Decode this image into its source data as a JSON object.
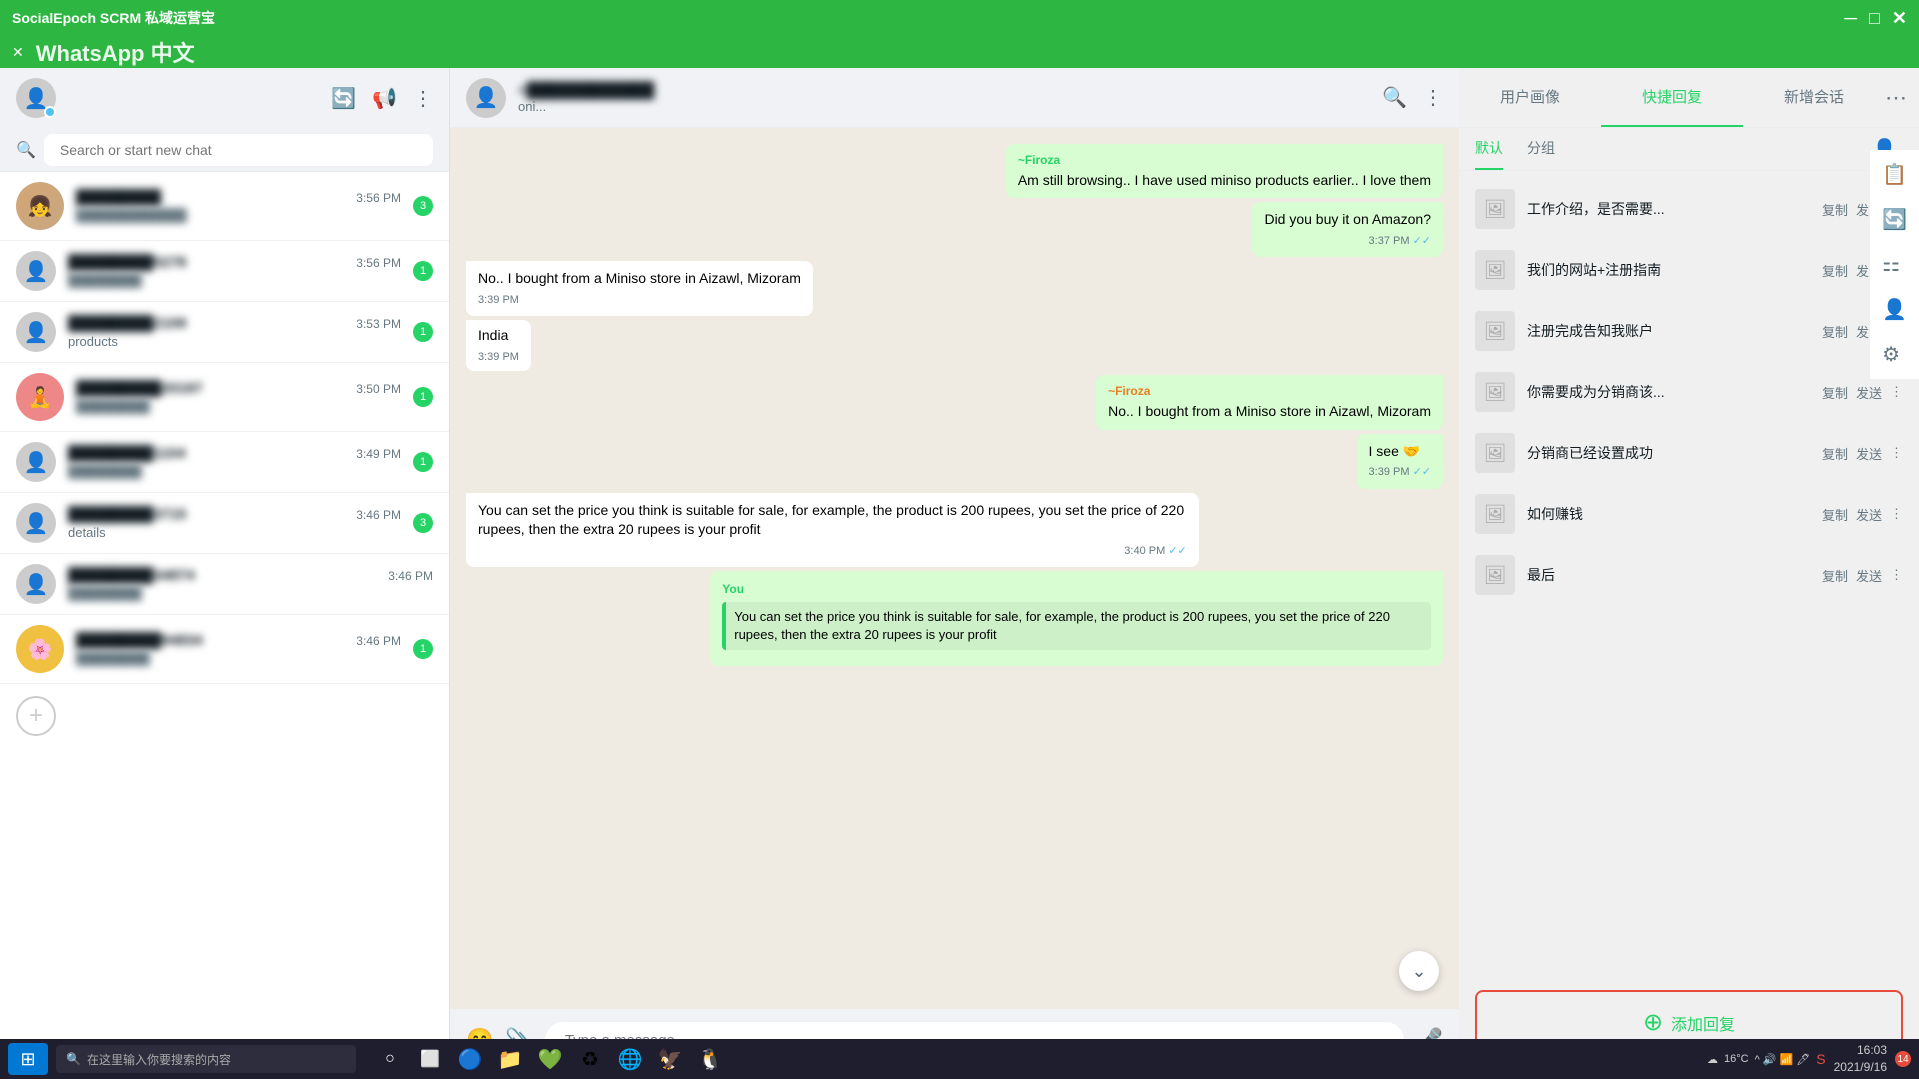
{
  "titlebar": {
    "title": "SocialEpoch SCRM 私域运营宝",
    "whatsapp_label": "WhatsApp 中文",
    "min_btn": "─",
    "max_btn": "□",
    "close_btn": "✕"
  },
  "sidebar": {
    "search_placeholder": "Search or start new chat",
    "add_btn": "+",
    "chats": [
      {
        "name": "Blurred5278",
        "time": "3:56 PM",
        "preview": "",
        "badge": "3",
        "has_avatar": true
      },
      {
        "name": "Blurred2109",
        "time": "3:53 PM",
        "preview": "products",
        "badge": "1",
        "has_avatar": false
      },
      {
        "name": "Blurred20197",
        "time": "3:50 PM",
        "preview": "",
        "badge": "1",
        "has_avatar": true
      },
      {
        "name": "Blurred1104",
        "time": "3:49 PM",
        "preview": "",
        "badge": "1",
        "has_avatar": false
      },
      {
        "name": "Blurred3715",
        "time": "3:46 PM",
        "preview": "details",
        "badge": "3",
        "has_avatar": false
      },
      {
        "name": "Blurred34874",
        "time": "3:46 PM",
        "preview": "",
        "badge": "0",
        "has_avatar": false
      },
      {
        "name": "Blurred94834",
        "time": "3:46 PM",
        "preview": "",
        "badge": "1",
        "has_avatar": true
      }
    ]
  },
  "chat": {
    "contact_name": "+ Blurred Name",
    "contact_status": "oni...",
    "messages": [
      {
        "id": 1,
        "type": "outgoing",
        "sender": "~Firoza",
        "text": "Am still browsing.. I have used miniso products earlier.. I love them",
        "time": "",
        "ticks": ""
      },
      {
        "id": 2,
        "type": "outgoing_plain",
        "text": "Did you buy it on Amazon?",
        "time": "3:37 PM",
        "ticks": "✓✓"
      },
      {
        "id": 3,
        "type": "incoming",
        "text": "No.. I bought from a Miniso store in Aizawl, Mizoram",
        "time": "3:39 PM",
        "ticks": ""
      },
      {
        "id": 4,
        "type": "incoming_plain",
        "text": "India",
        "time": "3:39 PM",
        "ticks": ""
      },
      {
        "id": 5,
        "type": "outgoing",
        "sender": "~Firoza",
        "text": "No.. I bought from a Miniso store in Aizawl, Mizoram",
        "time": "",
        "ticks": ""
      },
      {
        "id": 6,
        "type": "outgoing_emoji",
        "text": "I see 🤝",
        "time": "3:39 PM",
        "ticks": "✓✓"
      },
      {
        "id": 7,
        "type": "incoming_long",
        "text": "You can set the price you think is suitable for sale, for example, the product is 200 rupees, you set the price of 220 rupees, then the extra 20 rupees is your profit",
        "time": "3:40 PM",
        "ticks": "✓✓"
      },
      {
        "id": 8,
        "type": "quoted",
        "sender": "You",
        "quote": "You can set the price you think is suitable for sale, for example, the product is 200 rupees, you set the price of 220 rupees, then the extra 20 rupees is your profit",
        "text": "You can set the price you think is suitable for sale, for example, the product is 200 rupees, you set the price of 220 rupees, then the extra 20 rupees is your profit",
        "time": "",
        "ticks": ""
      }
    ],
    "input_placeholder": "Type a message"
  },
  "right_panel": {
    "tabs": [
      {
        "label": "用户画像",
        "active": false
      },
      {
        "label": "快捷回复",
        "active": false
      },
      {
        "label": "新增会话",
        "active": false
      }
    ],
    "more_icon": "⋯",
    "sub_tabs": [
      {
        "label": "默认",
        "active": true
      },
      {
        "label": "分组",
        "active": false
      }
    ],
    "quick_replies": [
      {
        "text": "工作介绍，是否需要...",
        "copy": "复制",
        "send": "发送"
      },
      {
        "text": "我们的网站+注册指南",
        "copy": "复制",
        "send": "发送"
      },
      {
        "text": "注册完成告知我账户",
        "copy": "复制",
        "send": "发送"
      },
      {
        "text": "你需要成为分销商该...",
        "copy": "复制",
        "send": "发送"
      },
      {
        "text": "分销商已经设置成功",
        "copy": "复制",
        "send": "发送"
      },
      {
        "text": "如何赚钱",
        "copy": "复制",
        "send": "发送"
      },
      {
        "text": "最后",
        "copy": "复制",
        "send": "发送"
      }
    ],
    "add_reply_btn": "添加回复",
    "side_icons": [
      "👤",
      "🔄",
      "⚙️",
      "📦",
      "👥"
    ]
  },
  "taskbar": {
    "start_icon": "⊞",
    "search_placeholder": "在这里输入你要搜索的内容",
    "time": "16:03",
    "date": "2021/9/16",
    "notification_badge": "14",
    "temperature": "16°C",
    "apps": [
      "○",
      "⬜",
      "🔵",
      "📁",
      "💚",
      "♻",
      "🌐",
      "🦅",
      "🐧"
    ]
  }
}
